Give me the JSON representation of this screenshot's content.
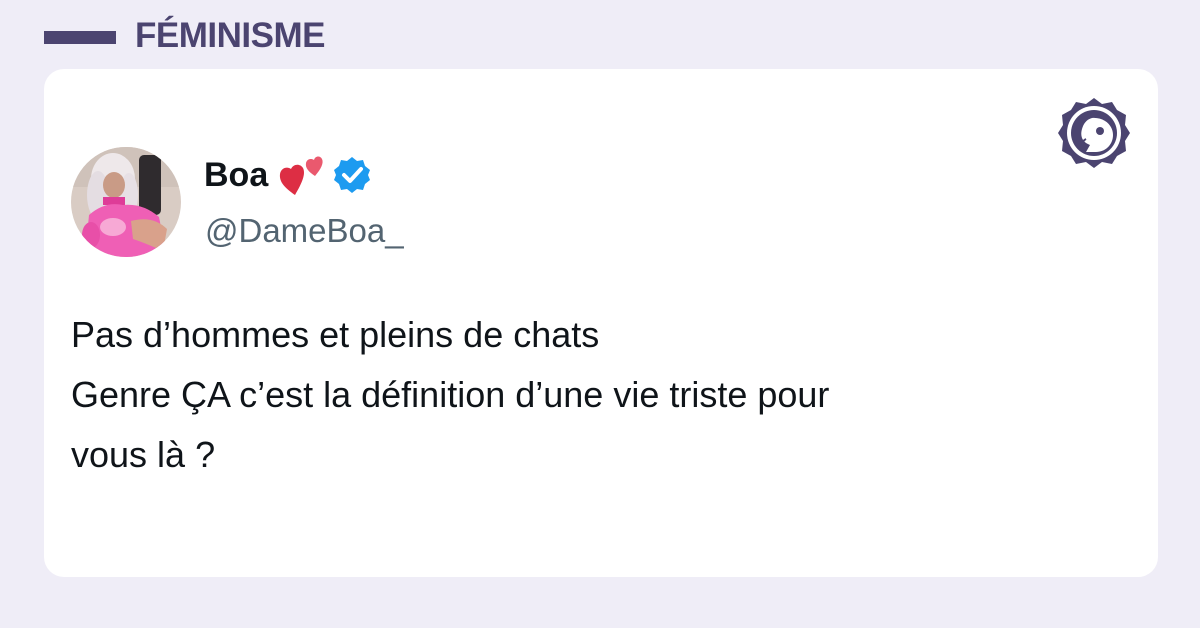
{
  "category": {
    "label": "FÉMINISME"
  },
  "tweet": {
    "display_name": "Boa",
    "handle": "@DameBoa_",
    "avatar_icon": "profile-photo",
    "name_emoji_icon": "two-hearts-icon",
    "verified_icon": "verified-badge-icon",
    "text_lines": [
      "Pas d’hommes et pleins de chats",
      "Genre ÇA c’est la définition d’une vie triste pour",
      "vous là ?"
    ]
  },
  "brand": {
    "logo_icon": "bird-face-badge-icon"
  },
  "colors": {
    "background": "#efedf7",
    "accent": "#4b4470",
    "verified": "#1d9bf0",
    "heart_red": "#dd2e44",
    "heart_pink": "#ea596e",
    "text": "#0f1419",
    "muted_text": "#536471"
  }
}
